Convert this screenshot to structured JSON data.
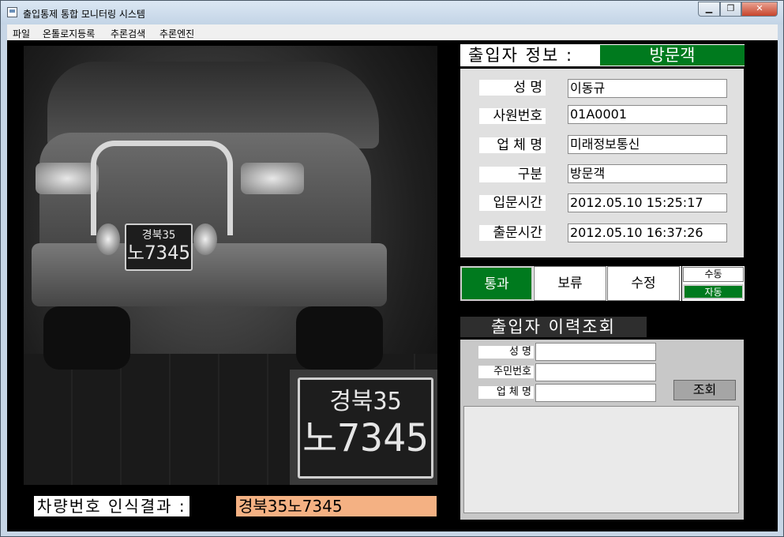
{
  "window": {
    "title": "출입통제 통합 모니터링 시스템",
    "controls": {
      "minimize": "▁",
      "maximize": "❐",
      "close": "✕"
    }
  },
  "menu": [
    "파일",
    "온톨로지등록",
    "추론검색",
    "추론엔진"
  ],
  "camera": {
    "plate_small": {
      "line1": "경북35",
      "line2": "노7345"
    },
    "plate_zoom": {
      "line1": "경북35",
      "line2": "노7345"
    }
  },
  "recognition": {
    "label": "차량번호 인식결과 :",
    "value": "경북35노7345"
  },
  "visitor_info": {
    "title": "출입자 정보 :",
    "type_badge": "방문객",
    "fields": [
      {
        "label": "성  명",
        "value": "이동규"
      },
      {
        "label": "사원번호",
        "value": "01A0001"
      },
      {
        "label": "업 체 명",
        "value": "미래정보통신"
      },
      {
        "label": "구분",
        "value": "방문객"
      },
      {
        "label": "입문시간",
        "value": "2012.05.10 15:25:17"
      },
      {
        "label": "출문시간",
        "value": "2012.05.10 16:37:26"
      }
    ]
  },
  "actions": {
    "pass": "통과",
    "hold": "보류",
    "edit": "수정",
    "mode_manual": "수동",
    "mode_auto": "자동"
  },
  "history": {
    "title": "출입자 이력조회",
    "fields": [
      {
        "label": "성  명",
        "value": ""
      },
      {
        "label": "주민번호",
        "value": ""
      },
      {
        "label": "업 체 명",
        "value": ""
      }
    ],
    "search_button": "조회"
  },
  "colors": {
    "accent_green": "#007a1e",
    "result_orange": "#f4b183"
  }
}
